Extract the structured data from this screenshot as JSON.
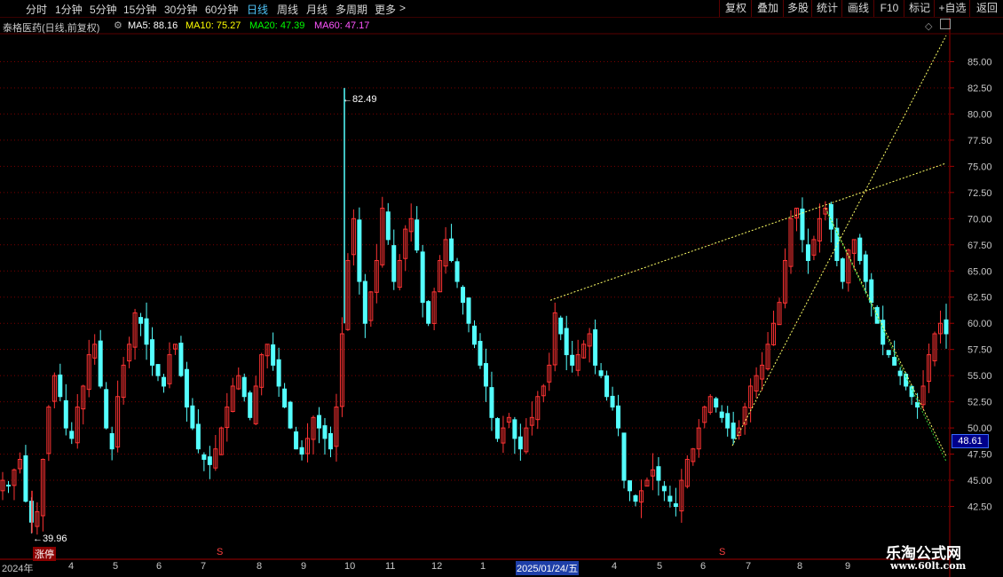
{
  "toolbar": {
    "tabs": [
      {
        "label": "分时",
        "active": false
      },
      {
        "label": "1分钟",
        "active": false
      },
      {
        "label": "5分钟",
        "active": false
      },
      {
        "label": "15分钟",
        "active": false
      },
      {
        "label": "30分钟",
        "active": false
      },
      {
        "label": "60分钟",
        "active": false
      },
      {
        "label": "日线",
        "active": true
      },
      {
        "label": "周线",
        "active": false
      },
      {
        "label": "月线",
        "active": false
      },
      {
        "label": "多周期",
        "active": false
      },
      {
        "label": "更多",
        "active": false
      }
    ],
    "more_arrow": ">",
    "buttons": [
      "复权",
      "叠加",
      "多股",
      "统计",
      "画线",
      "F10",
      "标记",
      "+自选",
      "返回"
    ]
  },
  "info": {
    "stock_name": "泰格医药(日线,前复权)",
    "ma5": "MA5: 88.16",
    "ma10": "MA10: 75.27",
    "ma20": "MA20: 47.39",
    "ma60": "MA60: 47.17"
  },
  "colors": {
    "up": "#ff3333",
    "down": "#54ffff",
    "ma5": "#ffffff",
    "ma10": "#ffff00",
    "ma20": "#00ff00",
    "ma60": "#ff00ff",
    "trend_yellow": "#ffff66",
    "trend_green": "#33cc33",
    "grid": "#7a0000"
  },
  "chart_data": {
    "type": "candlestick",
    "yaxis_ticks": [
      "85.00",
      "82.50",
      "80.00",
      "77.50",
      "75.00",
      "72.50",
      "70.00",
      "67.50",
      "65.00",
      "62.50",
      "60.00",
      "57.50",
      "55.00",
      "52.50",
      "50.00",
      "47.50",
      "45.00",
      "42.50"
    ],
    "ylim": [
      40.0,
      87.5
    ],
    "xaxis_labels": [
      "2024年",
      "4",
      "5",
      "6",
      "7",
      "8",
      "9",
      "10",
      "11",
      "12",
      "1",
      "2025/01/24/五",
      "4",
      "5",
      "6",
      "7",
      "8",
      "9"
    ],
    "high_label": "82.49",
    "low_label": "39.96",
    "current_price": "48.61",
    "closes": [
      45,
      44.5,
      46,
      47,
      43,
      41,
      42,
      47,
      52,
      55,
      53,
      50,
      49,
      52,
      54,
      57,
      58,
      54,
      50,
      48,
      53,
      56,
      58,
      61,
      60,
      58,
      56,
      55,
      54,
      57,
      58,
      55,
      52,
      50,
      48,
      47,
      46.5,
      48,
      50,
      52,
      54,
      55,
      53,
      51,
      54,
      57,
      58,
      56,
      54,
      52,
      50,
      48,
      47.5,
      49,
      51,
      50,
      49,
      48,
      52,
      59,
      66,
      70,
      64,
      60,
      63,
      66,
      71,
      68,
      64,
      66,
      69,
      70,
      67,
      62,
      60,
      63,
      66,
      68,
      66,
      64,
      62,
      60,
      58,
      56,
      54,
      51,
      49,
      50,
      51,
      49,
      48,
      50,
      51,
      53,
      54,
      56,
      61,
      59,
      57,
      56,
      57,
      58,
      59,
      56,
      55,
      53,
      52,
      50,
      45,
      44,
      43,
      44,
      45,
      46,
      45,
      44,
      43,
      42.5,
      45,
      47,
      48,
      50,
      52,
      53,
      52,
      51,
      50,
      49,
      50,
      52,
      54,
      55,
      56,
      58,
      60,
      62,
      66,
      70,
      71,
      68,
      66,
      68,
      70,
      71,
      69,
      66,
      64,
      67,
      68,
      66,
      64,
      62,
      60,
      58,
      57,
      56,
      55,
      54,
      53,
      52,
      54,
      57,
      59,
      60,
      59
    ],
    "high": 82.49,
    "low": 39.96
  },
  "annotations": {
    "zhangting_tag": "涨停",
    "s_marker": "S"
  },
  "watermark": {
    "line1": "乐淘公式网",
    "line2": "www.60lt.com"
  }
}
